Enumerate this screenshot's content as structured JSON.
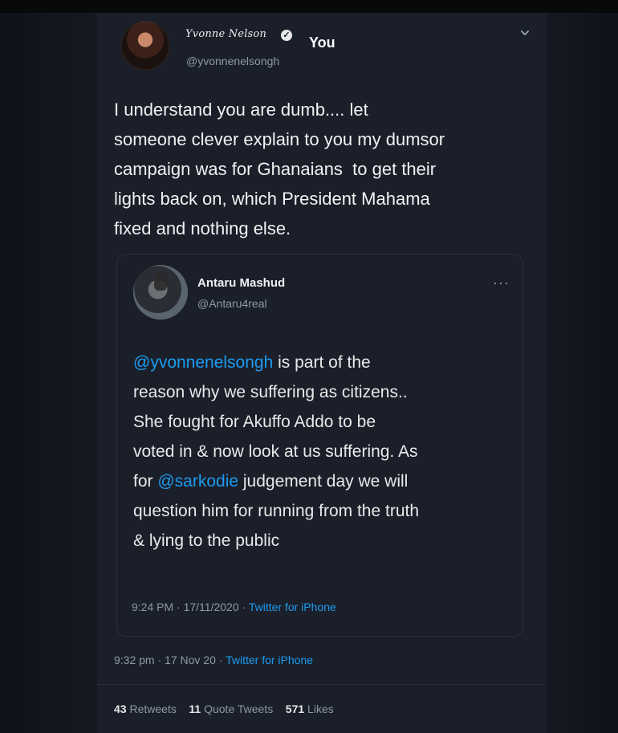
{
  "tweet": {
    "author_name": "Yvonne Nelson",
    "you_label": "You",
    "handle": "@yvonnenelsongh",
    "text": "I understand you are dumb.... let\nsomeone clever explain to you my dumsor\ncampaign was for Ghanaians  to get their\nlights back on, which President Mahama\nfixed and nothing else.",
    "time": "9:32 pm",
    "date": "17 Nov 20",
    "client": "Twitter for iPhone",
    "stats": {
      "retweets": "43",
      "retweets_label": "Retweets",
      "quotes": "11",
      "quotes_label": "Quote Tweets",
      "likes": "571",
      "likes_label": "Likes"
    }
  },
  "quoted": {
    "author_name": "Antaru Mashud",
    "handle": "@Antaru4real",
    "more": "···",
    "text_parts": {
      "mention1": "@yvonnenelsongh",
      "text1": " is part of the\nreason why we suffering as citizens..\nShe fought for Akuffo Addo to be\nvoted in & now look at us suffering. As\nfor ",
      "mention2": "@sarkodie",
      "text2": " judgement day we will\nquestion him for running from the truth\n& lying to the public"
    },
    "time": "9:24 PM",
    "date": "17/11/2020",
    "client": "Twitter for iPhone"
  },
  "colors": {
    "accent": "#1d9bf0",
    "text": "#f2f2f2",
    "muted": "#8e98a8",
    "card": "#1a1f2a"
  },
  "icons": {
    "verified": "verified-badge-icon",
    "chevron": "chevron-down-icon"
  }
}
